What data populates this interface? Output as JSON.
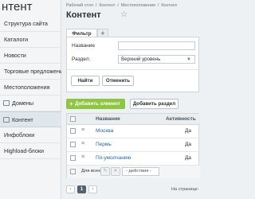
{
  "sidebar": {
    "title": "нтент",
    "items": [
      {
        "label": "Структура сайта",
        "icon": "",
        "active": false
      },
      {
        "label": "Каталоги",
        "icon": "",
        "active": false
      },
      {
        "label": "Новости",
        "icon": "",
        "active": false
      },
      {
        "label": "Торговые предложения",
        "icon": "",
        "active": false
      },
      {
        "label": "Местоположения",
        "icon": "",
        "active": false
      },
      {
        "label": "Домены",
        "icon": "folder-icon",
        "active": false
      },
      {
        "label": "Контент",
        "icon": "folder-icon",
        "active": true
      },
      {
        "label": "Инфоблоки",
        "icon": "",
        "active": false
      },
      {
        "label": "Highload-блоки",
        "icon": "",
        "active": false
      }
    ]
  },
  "breadcrumb": [
    "Рабочий стол",
    "Контент",
    "Местоположения",
    "Контент"
  ],
  "page": {
    "title": "Контент"
  },
  "filter": {
    "tab_label": "Фильтр",
    "add_tab_label": "+",
    "name_label": "Название",
    "name_value": "",
    "section_label": "Раздел:",
    "section_value": "Верхний уровень",
    "find_button": "Найти",
    "cancel_button": "Отменить"
  },
  "toolbar": {
    "add_element": "Добавить элемент",
    "add_section": "Добавить раздел"
  },
  "table": {
    "columns": [
      "Название",
      "Активность"
    ],
    "rows": [
      {
        "name": "Москва",
        "active": "Да"
      },
      {
        "name": "Пермь",
        "active": "Да"
      },
      {
        "name": "По-умолчанию",
        "active": "Да"
      }
    ],
    "footer": {
      "for_all_label": "Для всех",
      "action_placeholder": "- действия -"
    }
  },
  "pagination": {
    "current_page": "1",
    "prev": "‹",
    "next": "›",
    "per_page_label": "На странице:"
  },
  "colors": {
    "accent_green": "#8dc63f",
    "link_blue": "#2067b0",
    "active_item_bg": "#dfe7ec"
  }
}
